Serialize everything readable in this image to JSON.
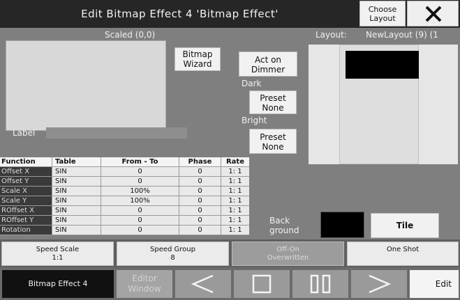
{
  "window": {
    "title": "Edit Bitmap Effect 4 'Bitmap Effect'",
    "choose_layout": "Choose Layout",
    "close_icon": "close-icon"
  },
  "preview": {
    "scaled_label": "Scaled (0,0)",
    "label_caption": "Label"
  },
  "buttons": {
    "bitmap_wizard": "Bitmap Wizard",
    "act_on_dimmer": "Act on Dimmer",
    "dark_caption": "Dark",
    "preset_none_dark": "Preset None",
    "bright_caption": "Bright",
    "preset_none_bright": "Preset None",
    "background_caption": "Back ground",
    "tile": "Tile"
  },
  "layout": {
    "caption": "Layout:",
    "name": "NewLayout (9) (1"
  },
  "table": {
    "headers": [
      "Function",
      "Table",
      "From - To",
      "Phase",
      "Rate"
    ],
    "rows": [
      [
        "Offset X",
        "SIN",
        "0",
        "0",
        "1: 1"
      ],
      [
        "Offset Y",
        "SIN",
        "0",
        "0",
        "1: 1"
      ],
      [
        "Scale X",
        "SIN",
        "100%",
        "0",
        "1: 1"
      ],
      [
        "Scale Y",
        "SIN",
        "100%",
        "0",
        "1: 1"
      ],
      [
        "ROffset X",
        "SIN",
        "0",
        "0",
        "1: 1"
      ],
      [
        "ROffset Y",
        "SIN",
        "0",
        "0",
        "1: 1"
      ],
      [
        "Rotation",
        "SIN",
        "0",
        "0",
        "1: 1"
      ]
    ]
  },
  "speed_bar": {
    "speed_scale": "Speed Scale",
    "speed_scale_value": "1:1",
    "speed_group": "Speed Group",
    "speed_group_value": "8",
    "off_on": "Off-On",
    "off_on_value": "Overwritten",
    "one_shot": "One Shot"
  },
  "bottom_bar": {
    "effect_name": "Bitmap Effect 4",
    "editor_window": "Editor Window",
    "edit": "Edit",
    "prev_icon": "prev-icon",
    "stop_icon": "stop-icon",
    "pause_icon": "pause-icon",
    "next_icon": "next-icon"
  }
}
